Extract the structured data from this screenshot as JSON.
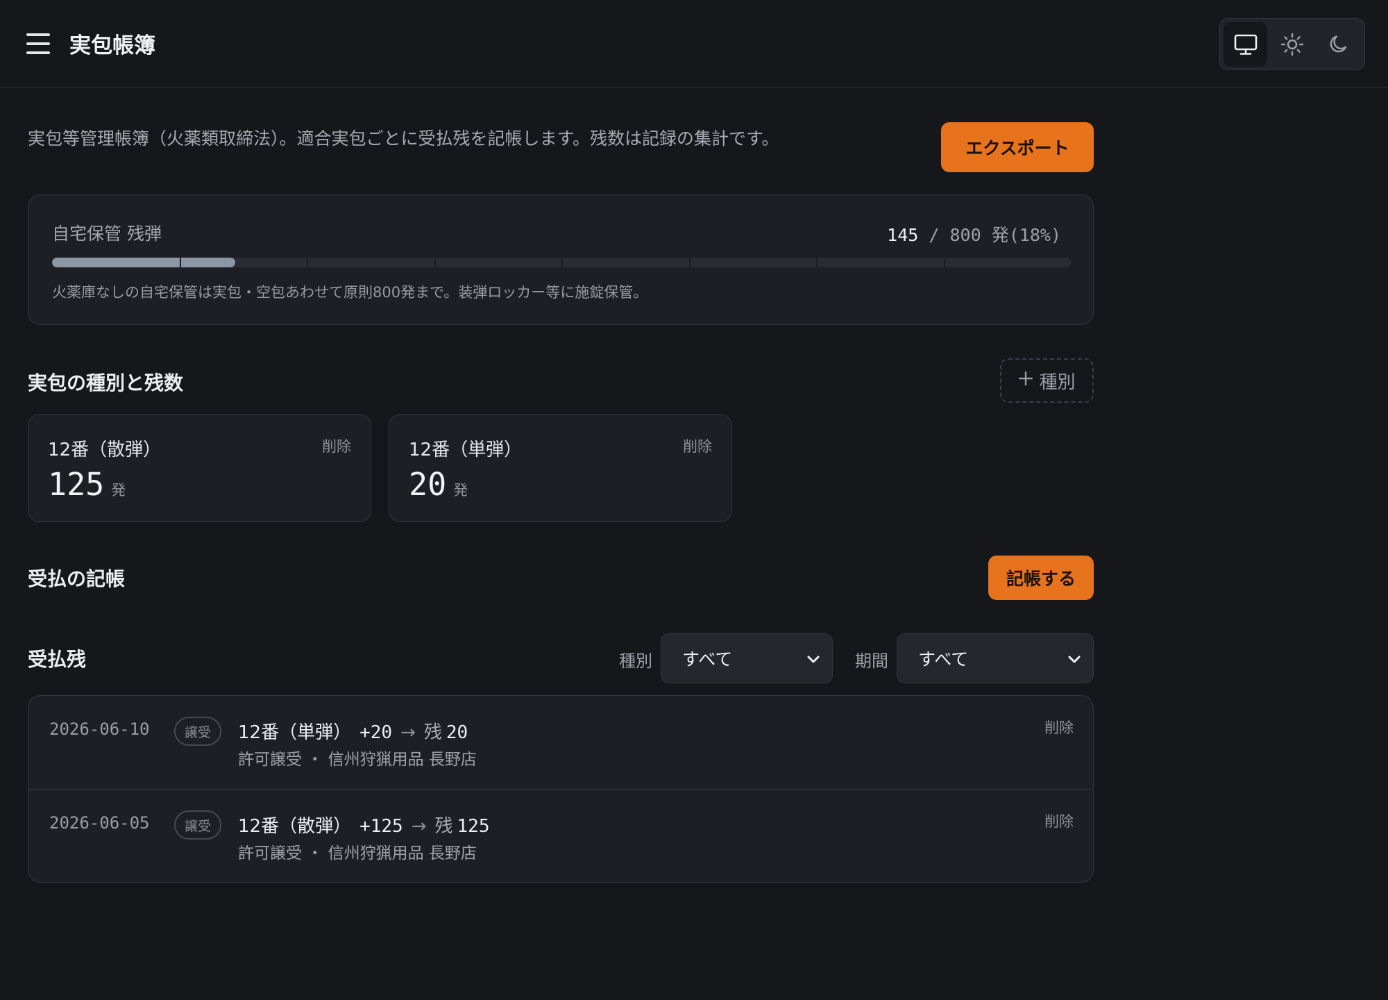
{
  "app": {
    "title": "実包帳簿"
  },
  "theme": {
    "options": [
      "monitor-icon",
      "sun-icon",
      "moon-icon"
    ],
    "selected": "monitor-icon"
  },
  "intro": {
    "text": "実包等管理帳簿（火薬類取締法）。適合実包ごとに受払残を記帳します。残数は記録の集計です。",
    "export_label": "エクスポート"
  },
  "capacity": {
    "label": "自宅保管 残弾",
    "current": "145",
    "separator": "/",
    "max": "800",
    "unit": "発",
    "percent_text": "(18%)",
    "fraction": 0.18,
    "note": "火薬庫なしの自宅保管は実包・空包あわせて原則800発まで。装弾ロッカー等に施錠保管。"
  },
  "types": {
    "title": "実包の種別と残数",
    "add_label": "種別",
    "items": [
      {
        "name": "12番（散弾）",
        "delete_label": "削除",
        "count": "125",
        "unit": "発"
      },
      {
        "name": "12番（単弾）",
        "delete_label": "削除",
        "count": "20",
        "unit": "発"
      }
    ]
  },
  "record": {
    "title": "受払の記帳",
    "button_label": "記帳する"
  },
  "ledger": {
    "title": "受払残",
    "filter_type_label": "種別",
    "filter_type_value": "すべて",
    "filter_period_label": "期間",
    "filter_period_value": "すべて",
    "rows": [
      {
        "date": "2026-06-10",
        "badge": "譲受",
        "type": "12番（単弾）",
        "change": "+20",
        "arrow": "→",
        "balance_label": "残",
        "balance": "20",
        "detail": "許可譲受 ・ 信州狩猟用品 長野店",
        "delete_label": "削除"
      },
      {
        "date": "2026-06-05",
        "badge": "譲受",
        "type": "12番（散弾）",
        "change": "+125",
        "arrow": "→",
        "balance_label": "残",
        "balance": "125",
        "detail": "許可譲受 ・ 信州狩猟用品 長野店",
        "delete_label": "削除"
      }
    ]
  },
  "colors": {
    "background": "#16171b",
    "card": "#1e1f24",
    "accent": "#e8731d",
    "capacity_fill": "#8d96a4"
  }
}
